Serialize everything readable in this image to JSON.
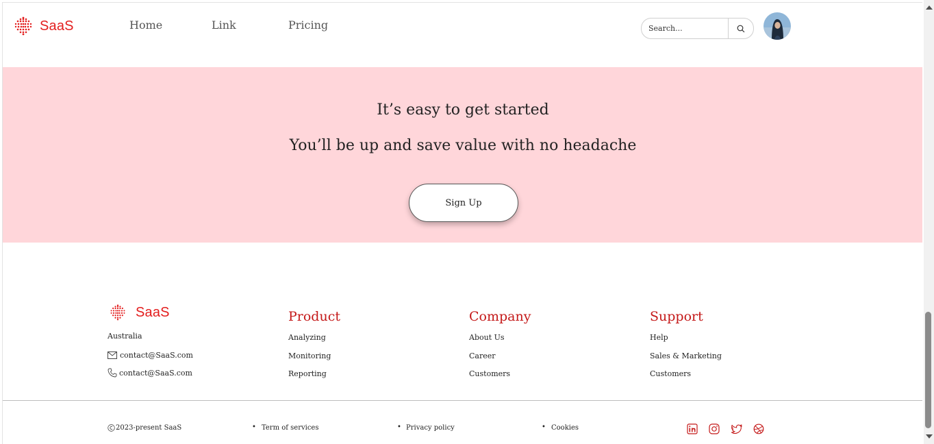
{
  "header": {
    "brand": "SaaS",
    "nav": [
      "Home",
      "Link",
      "Pricing"
    ],
    "search_placeholder": "Search..."
  },
  "hero": {
    "line1": "It’s easy to get started",
    "line2": "You’ll be up and save value with no headache",
    "cta_label": "Sign Up"
  },
  "footer": {
    "brand": "SaaS",
    "location": "Australia",
    "email": "contact@SaaS.com",
    "phone": "contact@SaaS.com",
    "columns": [
      {
        "heading": "Product",
        "links": [
          "Analyzing",
          "Monitoring",
          "Reporting"
        ]
      },
      {
        "heading": "Company",
        "links": [
          "About Us",
          "Career",
          "Customers"
        ]
      },
      {
        "heading": "Support",
        "links": [
          "Help",
          "Sales & Marketing",
          "Customers"
        ]
      }
    ],
    "copyright": "2023-present SaaS",
    "legal": [
      "Term of services",
      "Privacy policy",
      "Cookies"
    ],
    "social_icons": [
      "linkedin-icon",
      "instagram-icon",
      "twitter-icon",
      "dribbble-icon"
    ]
  },
  "colors": {
    "brand": "#e31d1d",
    "heading": "#c41818",
    "hero_bg": "#ffd6da"
  }
}
